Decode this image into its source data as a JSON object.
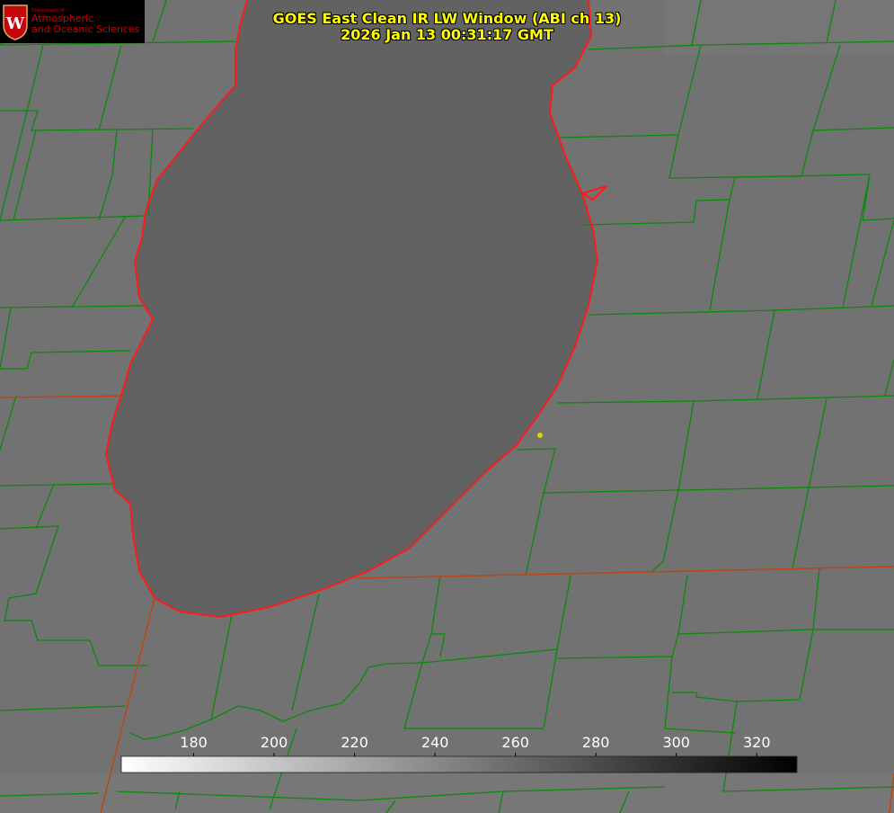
{
  "title": {
    "line1": "GOES East Clean IR LW Window (ABI ch 13)",
    "line2": "2026 Jan 13 00:31:17 GMT"
  },
  "logo": {
    "department": "Department of",
    "line1": "Atmospheric",
    "line2": "and Oceanic Sciences",
    "seal_letter": "W"
  },
  "colorbar": {
    "ticks": [
      "180",
      "200",
      "220",
      "240",
      "260",
      "280",
      "300",
      "320"
    ],
    "min_value": 162,
    "max_value": 330,
    "colors": {
      "low": "#ffffff",
      "high": "#000000"
    }
  },
  "colors": {
    "lake_outline": "#ff1a1a",
    "county_lines": "#0a8a0a",
    "state_lines": "#b84818",
    "marker": "#d6d600",
    "title_text": "#ffff00"
  }
}
